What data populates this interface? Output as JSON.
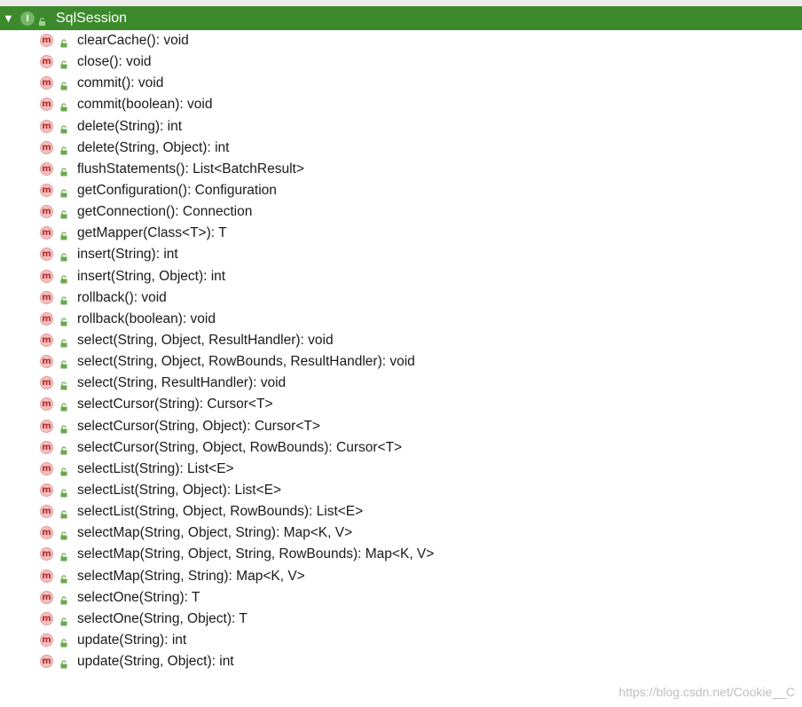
{
  "window": {
    "class_name": "SqlSession",
    "expand_icon": "triangle-down-icon",
    "class_icon": "interface-icon",
    "class_icon_letter": "I"
  },
  "colors": {
    "header_bg": "#3c8a2c",
    "method_icon_bg": "#f4bfbf",
    "method_icon_text": "#b0302e",
    "access_icon": "#6aa84f"
  },
  "members": [
    {
      "icon": "method-icon",
      "icon_letter": "m",
      "access": "public-access-icon",
      "signature": "clearCache(): void"
    },
    {
      "icon": "method-icon",
      "icon_letter": "m",
      "access": "public-access-icon",
      "signature": "close(): void"
    },
    {
      "icon": "method-icon",
      "icon_letter": "m",
      "access": "public-access-icon",
      "signature": "commit(): void"
    },
    {
      "icon": "method-icon",
      "icon_letter": "m",
      "access": "public-access-icon",
      "signature": "commit(boolean): void"
    },
    {
      "icon": "method-icon",
      "icon_letter": "m",
      "access": "public-access-icon",
      "signature": "delete(String): int"
    },
    {
      "icon": "method-icon",
      "icon_letter": "m",
      "access": "public-access-icon",
      "signature": "delete(String, Object): int"
    },
    {
      "icon": "method-icon",
      "icon_letter": "m",
      "access": "public-access-icon",
      "signature": "flushStatements(): List<BatchResult>"
    },
    {
      "icon": "method-icon",
      "icon_letter": "m",
      "access": "public-access-icon",
      "signature": "getConfiguration(): Configuration"
    },
    {
      "icon": "method-icon",
      "icon_letter": "m",
      "access": "public-access-icon",
      "signature": "getConnection(): Connection"
    },
    {
      "icon": "method-icon",
      "icon_letter": "m",
      "access": "public-access-icon",
      "signature": "getMapper(Class<T>): T"
    },
    {
      "icon": "method-icon",
      "icon_letter": "m",
      "access": "public-access-icon",
      "signature": "insert(String): int"
    },
    {
      "icon": "method-icon",
      "icon_letter": "m",
      "access": "public-access-icon",
      "signature": "insert(String, Object): int"
    },
    {
      "icon": "method-icon",
      "icon_letter": "m",
      "access": "public-access-icon",
      "signature": "rollback(): void"
    },
    {
      "icon": "method-icon",
      "icon_letter": "m",
      "access": "public-access-icon",
      "signature": "rollback(boolean): void"
    },
    {
      "icon": "method-icon",
      "icon_letter": "m",
      "access": "public-access-icon",
      "signature": "select(String, Object, ResultHandler): void"
    },
    {
      "icon": "method-icon",
      "icon_letter": "m",
      "access": "public-access-icon",
      "signature": "select(String, Object, RowBounds, ResultHandler): void"
    },
    {
      "icon": "method-icon",
      "icon_letter": "m",
      "access": "public-access-icon",
      "signature": "select(String, ResultHandler): void"
    },
    {
      "icon": "method-icon",
      "icon_letter": "m",
      "access": "public-access-icon",
      "signature": "selectCursor(String): Cursor<T>"
    },
    {
      "icon": "method-icon",
      "icon_letter": "m",
      "access": "public-access-icon",
      "signature": "selectCursor(String, Object): Cursor<T>"
    },
    {
      "icon": "method-icon",
      "icon_letter": "m",
      "access": "public-access-icon",
      "signature": "selectCursor(String, Object, RowBounds): Cursor<T>"
    },
    {
      "icon": "method-icon",
      "icon_letter": "m",
      "access": "public-access-icon",
      "signature": "selectList(String): List<E>"
    },
    {
      "icon": "method-icon",
      "icon_letter": "m",
      "access": "public-access-icon",
      "signature": "selectList(String, Object): List<E>"
    },
    {
      "icon": "method-icon",
      "icon_letter": "m",
      "access": "public-access-icon",
      "signature": "selectList(String, Object, RowBounds): List<E>"
    },
    {
      "icon": "method-icon",
      "icon_letter": "m",
      "access": "public-access-icon",
      "signature": "selectMap(String, Object, String): Map<K, V>"
    },
    {
      "icon": "method-icon",
      "icon_letter": "m",
      "access": "public-access-icon",
      "signature": "selectMap(String, Object, String, RowBounds): Map<K, V>"
    },
    {
      "icon": "method-icon",
      "icon_letter": "m",
      "access": "public-access-icon",
      "signature": "selectMap(String, String): Map<K, V>"
    },
    {
      "icon": "method-icon",
      "icon_letter": "m",
      "access": "public-access-icon",
      "signature": "selectOne(String): T"
    },
    {
      "icon": "method-icon",
      "icon_letter": "m",
      "access": "public-access-icon",
      "signature": "selectOne(String, Object): T"
    },
    {
      "icon": "method-icon",
      "icon_letter": "m",
      "access": "public-access-icon",
      "signature": "update(String): int"
    },
    {
      "icon": "method-icon",
      "icon_letter": "m",
      "access": "public-access-icon",
      "signature": "update(String, Object): int"
    }
  ],
  "watermark": "https://blog.csdn.net/Cookie__C"
}
